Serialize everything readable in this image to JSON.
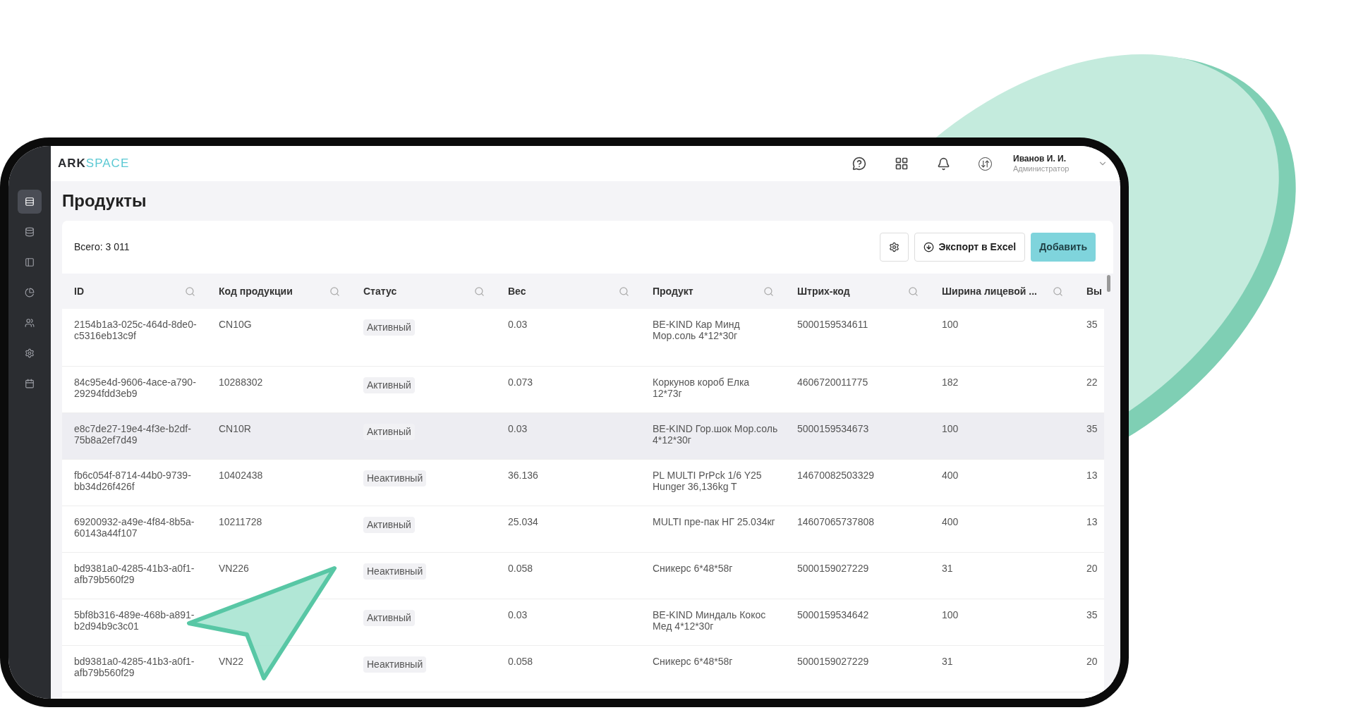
{
  "header": {
    "logo_bold": "ARK",
    "logo_light": "SPACE",
    "user": {
      "name": "Иванов И. И.",
      "role": "Администратор"
    }
  },
  "sidebar": {
    "items": [
      {
        "selected": true
      },
      {
        "selected": false
      },
      {
        "selected": false
      },
      {
        "selected": false
      },
      {
        "selected": false
      },
      {
        "selected": false
      },
      {
        "selected": false
      }
    ]
  },
  "page_title": "Продукты",
  "toolbar": {
    "total": "Всего: 3 011",
    "export_button": "Экспорт в Excel",
    "add_button": "Добавить"
  },
  "table": {
    "columns": [
      {
        "label": "ID",
        "kind": "text",
        "search": true
      },
      {
        "label": "Код продукции",
        "kind": "text",
        "search": true
      },
      {
        "label": "Статус",
        "kind": "badge",
        "search": true
      },
      {
        "label": "Вес",
        "kind": "text",
        "search": true
      },
      {
        "label": "Продукт",
        "kind": "text",
        "search": true
      },
      {
        "label": "Штрих-код",
        "kind": "text",
        "search": true
      },
      {
        "label": "Ширина лицевой ...",
        "kind": "text",
        "search": true
      },
      {
        "label": "Вы",
        "kind": "text",
        "search": false
      }
    ],
    "rows": [
      {
        "selected": false,
        "cells": [
          "2154b1a3-025c-464d-8de0-c5316eb13c9f",
          "CN10G",
          "Активный",
          "0.03",
          "BE-KIND Кар Минд Мор.соль 4*12*30г",
          "5000159534611",
          "100",
          "35"
        ]
      },
      {
        "selected": false,
        "cells": [
          "84c95e4d-9606-4ace-a790-29294fdd3eb9",
          "10288302",
          "Активный",
          "0.073",
          "Коркунов короб Елка 12*73г",
          "4606720011775",
          "182",
          "22"
        ]
      },
      {
        "selected": true,
        "cells": [
          "e8c7de27-19e4-4f3e-b2df-75b8a2ef7d49",
          "CN10R",
          "Активный",
          "0.03",
          "BE-KIND Гор.шок Мор.соль 4*12*30г",
          "5000159534673",
          "100",
          "35"
        ]
      },
      {
        "selected": false,
        "cells": [
          "fb6c054f-8714-44b0-9739-bb34d26f426f",
          "10402438",
          "Неактивный",
          "36.136",
          "PL MULTI PrPck 1/6 Y25 Hunger 36,136kg T",
          "14670082503329",
          "400",
          "13"
        ]
      },
      {
        "selected": false,
        "cells": [
          "69200932-a49e-4f84-8b5a-60143a44f107",
          "10211728",
          "Активный",
          "25.034",
          "MULTI пре-пак НГ 25.034кг",
          "14607065737808",
          "400",
          "13"
        ]
      },
      {
        "selected": false,
        "cells": [
          "bd9381a0-4285-41b3-a0f1-afb79b560f29",
          "VN226",
          "Неактивный",
          "0.058",
          "Сникерс 6*48*58г",
          "5000159027229",
          "31",
          "20"
        ]
      },
      {
        "selected": false,
        "cells": [
          "5bf8b316-489e-468b-a891-b2d94b9c3c01",
          null,
          "Активный",
          "0.03",
          "BE-KIND Миндаль Кокос Мед 4*12*30г",
          "5000159534642",
          "100",
          "35"
        ]
      },
      {
        "selected": false,
        "cells": [
          "bd9381a0-4285-41b3-a0f1-afb79b560f29",
          "VN22",
          "Неактивный",
          "0.058",
          "Сникерс 6*48*58г",
          "5000159027229",
          "31",
          "20"
        ]
      }
    ]
  }
}
